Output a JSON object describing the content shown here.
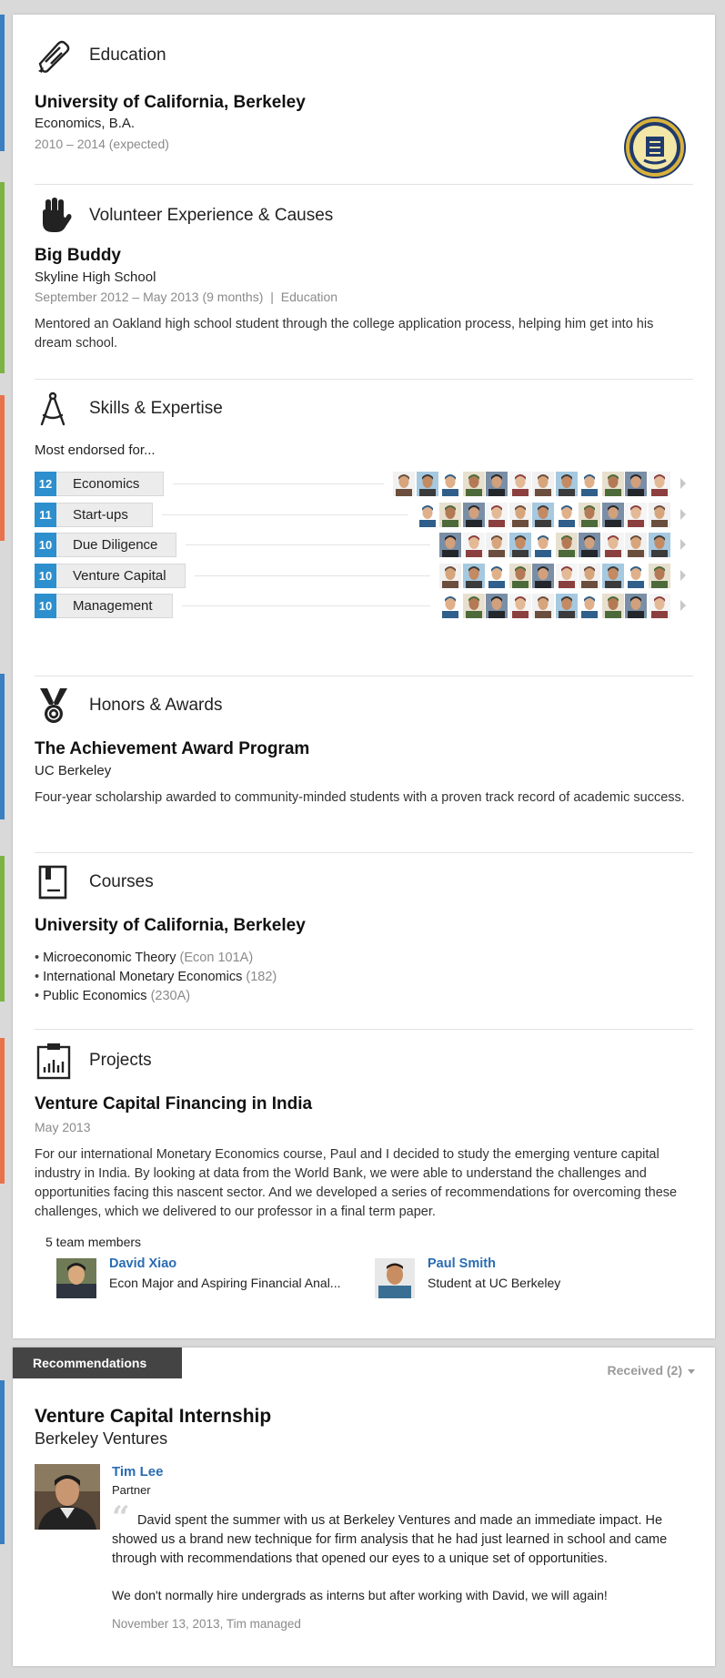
{
  "education": {
    "heading": "Education",
    "school": "University of California, Berkeley",
    "degree": "Economics, B.A.",
    "dates": "2010 – 2014 (expected)"
  },
  "volunteer": {
    "heading": "Volunteer Experience & Causes",
    "role": "Big Buddy",
    "organization": "Skyline High School",
    "dates": "September 2012 – May 2013 (9 months)",
    "separator": "|",
    "cause": "Education",
    "description": "Mentored an Oakland high school student through the college application process, helping him get into his dream school."
  },
  "skills": {
    "heading": "Skills & Expertise",
    "subheading": "Most endorsed for...",
    "items": [
      {
        "count": "12",
        "name": "Economics",
        "endorsers": 12
      },
      {
        "count": "11",
        "name": "Start-ups",
        "endorsers": 11
      },
      {
        "count": "10",
        "name": "Due Diligence",
        "endorsers": 10
      },
      {
        "count": "10",
        "name": "Venture Capital",
        "endorsers": 10
      },
      {
        "count": "10",
        "name": "Management",
        "endorsers": 10
      }
    ]
  },
  "honors": {
    "heading": "Honors & Awards",
    "title": "The Achievement Award Program",
    "issuer": "UC Berkeley",
    "description": "Four-year scholarship awarded to community-minded students with a proven track record of academic success."
  },
  "courses": {
    "heading": "Courses",
    "school": "University of California, Berkeley",
    "items": [
      {
        "name": "Microeconomic Theory",
        "code": "(Econ 101A)"
      },
      {
        "name": "International Monetary Economics",
        "code": "(182)"
      },
      {
        "name": "Public Economics",
        "code": "(230A)"
      }
    ]
  },
  "projects": {
    "heading": "Projects",
    "title": "Venture Capital Financing in India",
    "date": "May 2013",
    "description": "For our international Monetary Economics course, Paul and I decided to study the emerging venture capital industry in India. By looking at data from the World Bank, we were able to understand the challenges and opportunities facing this nascent sector. And we developed a series of recommendations for overcoming these challenges, which we delivered to our professor in a final term paper.",
    "team_label": "5 team members",
    "members": [
      {
        "name": "David Xiao",
        "title": "Econ Major and Aspiring Financial Anal..."
      },
      {
        "name": "Paul Smith",
        "title": "Student at UC Berkeley"
      }
    ]
  },
  "recommendations": {
    "tab_label": "Recommendations",
    "filter_label": "Received (2)",
    "position": "Venture Capital Internship",
    "company": "Berkeley Ventures",
    "recommender_name": "Tim Lee",
    "recommender_title": "Partner",
    "quote_1": "David spent the summer with us at Berkeley Ventures and made an immediate impact. He showed us a brand new technique for firm analysis that he had just learned in school and came through with recommendations that opened our eyes to a unique set of opportunities.",
    "quote_2": "We don't normally hire undergrads as interns but after working with David, we will again!",
    "date": "November 13, 2013,",
    "relationship": "Tim managed"
  },
  "colors": {
    "accent_blue": "#2d8fce",
    "link_blue": "#2a6cb2",
    "accent_green": "#7cb342",
    "accent_orange": "#e8734a"
  }
}
